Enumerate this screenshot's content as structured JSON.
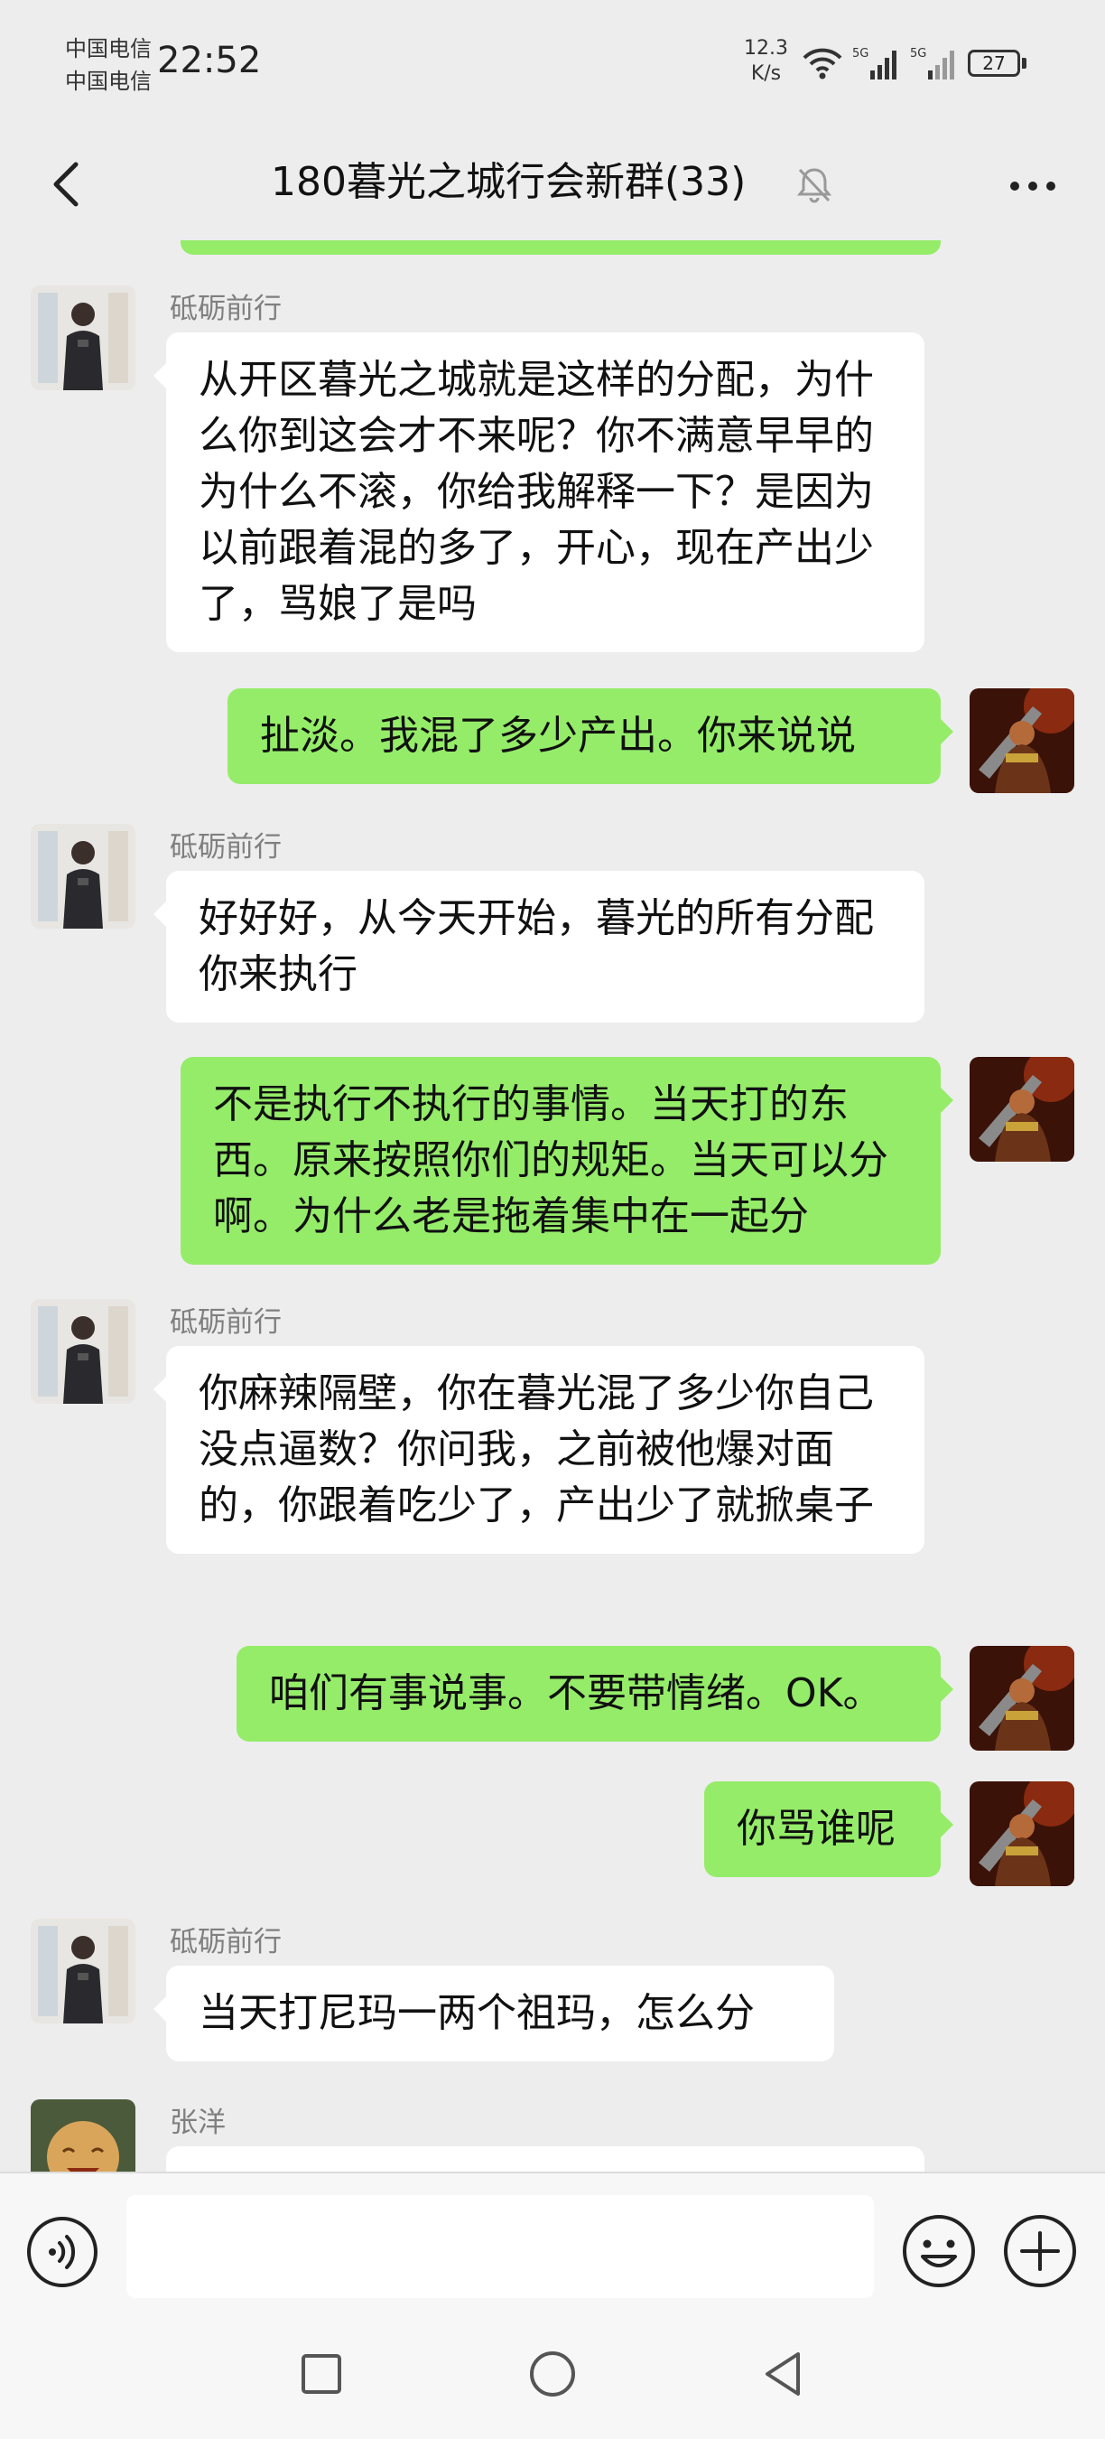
{
  "status_bar": {
    "carrier_1": "中国电信",
    "carrier_2": "中国电信",
    "time": "22:52",
    "net_speed_value": "12.3",
    "net_speed_unit": "K/s",
    "wifi_icon": "wifi-icon",
    "signal_1_label": "5G",
    "signal_2_label": "5G",
    "battery": "27"
  },
  "header": {
    "title": "180暮光之城行会新群(33)",
    "back_icon": "chevron-left-icon",
    "mute_icon": "bell-mute-icon",
    "more_icon": "more-dots-icon"
  },
  "messages": [
    {
      "side": "in",
      "sender": "砥砺前行",
      "avatar": "man-photo-avatar",
      "text": "从开区暮光之城就是这样的分配，为什么你到这会才不来呢？你不满意早早的为什么不滚，你给我解释一下？是因为以前跟着混的多了，开心，现在产出少了，骂娘了是吗"
    },
    {
      "side": "out",
      "avatar": "warrior-avatar",
      "text": "扯淡。我混了多少产出。你来说说"
    },
    {
      "side": "in",
      "sender": "砥砺前行",
      "avatar": "man-photo-avatar",
      "text": "好好好，从今天开始，暮光的所有分配你来执行"
    },
    {
      "side": "out",
      "avatar": "warrior-avatar",
      "text": "不是执行不执行的事情。当天打的东西。原来按照你们的规矩。当天可以分啊。为什么老是拖着集中在一起分"
    },
    {
      "side": "in",
      "sender": "砥砺前行",
      "avatar": "man-photo-avatar",
      "text": "你麻辣隔壁，你在暮光混了多少你自己没点逼数？你问我，之前被他爆对面的，你跟着吃少了，产出少了就掀桌子"
    },
    {
      "side": "out",
      "avatar": "warrior-avatar",
      "text": "咱们有事说事。不要带情绪。OK。"
    },
    {
      "side": "out",
      "avatar": "warrior-avatar",
      "text": "你骂谁呢"
    },
    {
      "side": "in",
      "sender": "砥砺前行",
      "avatar": "man-photo-avatar",
      "text": "当天打尼玛一两个祖玛，怎么分"
    },
    {
      "side": "in",
      "sender": "张洋",
      "avatar": "buddha-avatar",
      "text": ""
    }
  ],
  "input_bar": {
    "voice_icon": "voice-icon",
    "text_value": "",
    "emoji_icon": "emoji-icon",
    "plus_icon": "plus-icon"
  },
  "nav_bar": {
    "recents_icon": "square-icon",
    "home_icon": "circle-icon",
    "back_icon": "triangle-back-icon"
  },
  "colors": {
    "background": "#ededed",
    "outgoing_bubble": "#95ec69",
    "incoming_bubble": "#ffffff",
    "sender_name": "#7f7f7f"
  }
}
